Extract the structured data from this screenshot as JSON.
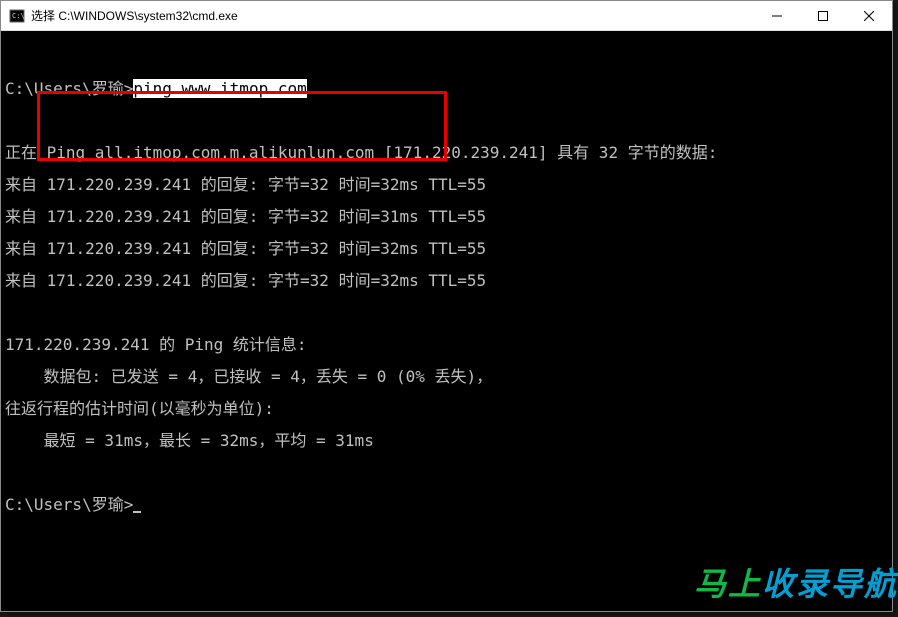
{
  "window": {
    "title": "选择 C:\\WINDOWS\\system32\\cmd.exe"
  },
  "prompt1": {
    "prefix": "C:\\Users\\罗瑜>",
    "command": "ping www.itmop.com"
  },
  "ping_header": "正在 Ping all.itmop.com.m.alikunlun.com [171.220.239.241] 具有 32 字节的数据:",
  "replies": [
    {
      "prefix": "来自 ",
      "body": "171.220.239.241 的回复: 字节=32 时间=32ms TTL=55"
    },
    {
      "prefix": "来自 ",
      "body": "171.220.239.241 的回复: 字节=32 时间=31ms TTL=55"
    },
    {
      "prefix": "来自 ",
      "body": "171.220.239.241 的回复: 字节=32 时间=32ms TTL=55"
    },
    {
      "prefix": "来自 ",
      "body": "171.220.239.241 的回复: 字节=32 时间=32ms TTL=55"
    }
  ],
  "stats": {
    "header": "171.220.239.241 的 Ping 统计信息:",
    "packets": "    数据包: 已发送 = 4，已接收 = 4，丢失 = 0 (0% 丢失)，",
    "rtt_header": "往返行程的估计时间(以毫秒为单位):",
    "rtt_values": "    最短 = 31ms，最长 = 32ms，平均 = 31ms"
  },
  "prompt2": {
    "prefix": "C:\\Users\\罗瑜>"
  },
  "watermark": {
    "part1": "马上",
    "part2": "收录导航"
  }
}
